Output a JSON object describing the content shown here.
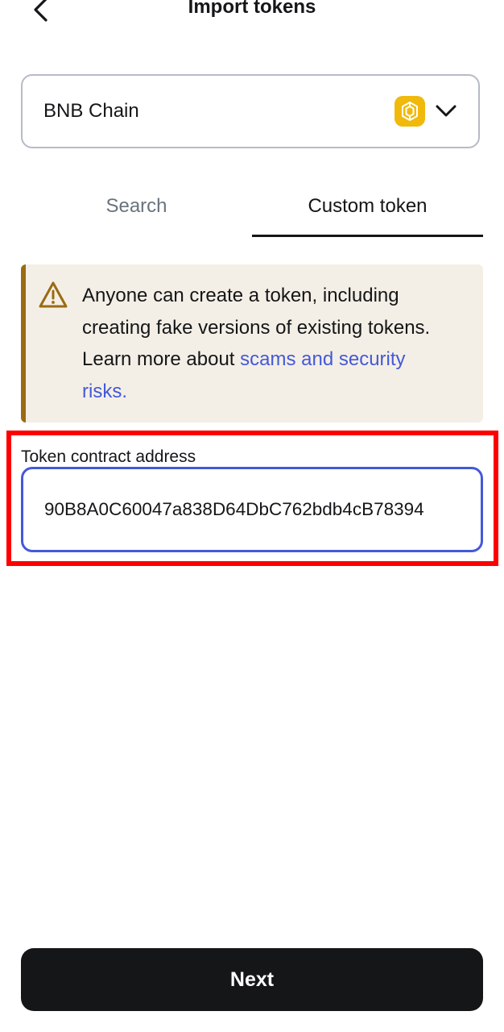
{
  "header": {
    "title": "Import tokens",
    "back_icon": "chevron-left-icon"
  },
  "network_selector": {
    "selected": "BNB Chain",
    "logo_color": "#f0b90b",
    "chevron_icon": "chevron-down-icon"
  },
  "tabs": [
    {
      "label": "Search",
      "active": false
    },
    {
      "label": "Custom token",
      "active": true
    }
  ],
  "warning": {
    "icon": "warning-triangle-icon",
    "text": "Anyone can create a token, including creating fake versions of existing tokens. Learn more about ",
    "link_text": "scams and security risks.",
    "accent_color": "#9b6a13",
    "background_color": "#f4efe6"
  },
  "address_field": {
    "label": "Token contract address",
    "value": "90B8A0C60047a838D64DbC762bdb4cB78394"
  },
  "footer": {
    "next_label": "Next"
  },
  "colors": {
    "primary_text": "#141618",
    "link": "#4459d8",
    "highlight_border": "#ff0000"
  }
}
